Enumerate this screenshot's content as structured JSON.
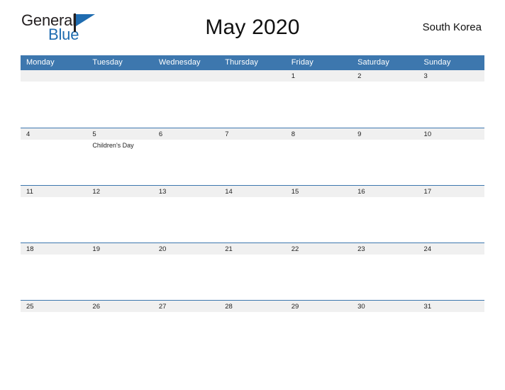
{
  "brand": {
    "name_part1": "General",
    "name_part2": "Blue",
    "flag_icon": "flag-triangle-icon",
    "accent_color": "#1f6cb0"
  },
  "header": {
    "title": "May 2020",
    "country": "South Korea"
  },
  "theme": {
    "header_blue": "#3d77ae",
    "row_line_blue": "#3d77ae",
    "date_band_gray": "#f0f0f0",
    "cell_white": "#ffffff"
  },
  "calendar": {
    "month": "May",
    "year": "2020",
    "weekday_start": "Monday",
    "weekdays": [
      "Monday",
      "Tuesday",
      "Wednesday",
      "Thursday",
      "Friday",
      "Saturday",
      "Sunday"
    ],
    "weeks": [
      [
        {
          "date": "",
          "event": ""
        },
        {
          "date": "",
          "event": ""
        },
        {
          "date": "",
          "event": ""
        },
        {
          "date": "",
          "event": ""
        },
        {
          "date": "1",
          "event": ""
        },
        {
          "date": "2",
          "event": ""
        },
        {
          "date": "3",
          "event": ""
        }
      ],
      [
        {
          "date": "4",
          "event": ""
        },
        {
          "date": "5",
          "event": "Children's Day"
        },
        {
          "date": "6",
          "event": ""
        },
        {
          "date": "7",
          "event": ""
        },
        {
          "date": "8",
          "event": ""
        },
        {
          "date": "9",
          "event": ""
        },
        {
          "date": "10",
          "event": ""
        }
      ],
      [
        {
          "date": "11",
          "event": ""
        },
        {
          "date": "12",
          "event": ""
        },
        {
          "date": "13",
          "event": ""
        },
        {
          "date": "14",
          "event": ""
        },
        {
          "date": "15",
          "event": ""
        },
        {
          "date": "16",
          "event": ""
        },
        {
          "date": "17",
          "event": ""
        }
      ],
      [
        {
          "date": "18",
          "event": ""
        },
        {
          "date": "19",
          "event": ""
        },
        {
          "date": "20",
          "event": ""
        },
        {
          "date": "21",
          "event": ""
        },
        {
          "date": "22",
          "event": ""
        },
        {
          "date": "23",
          "event": ""
        },
        {
          "date": "24",
          "event": ""
        }
      ],
      [
        {
          "date": "25",
          "event": ""
        },
        {
          "date": "26",
          "event": ""
        },
        {
          "date": "27",
          "event": ""
        },
        {
          "date": "28",
          "event": ""
        },
        {
          "date": "29",
          "event": ""
        },
        {
          "date": "30",
          "event": ""
        },
        {
          "date": "31",
          "event": ""
        }
      ]
    ]
  }
}
